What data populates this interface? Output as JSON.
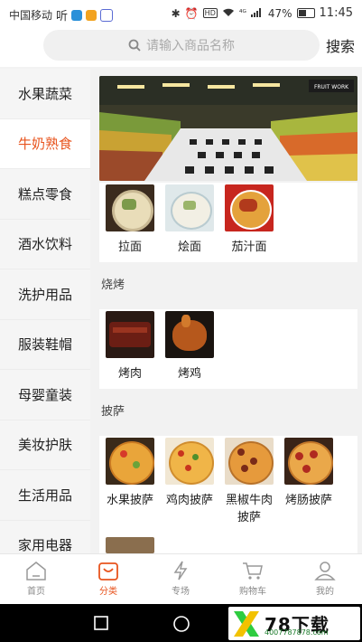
{
  "status": {
    "carrier": "中国移动",
    "hd": "HD",
    "network": "⁴ᴳ",
    "battery": "47%",
    "time": "11:45"
  },
  "search": {
    "placeholder": "请输入商品名称",
    "button": "搜索"
  },
  "sidebar": {
    "items": [
      {
        "label": "水果蔬菜"
      },
      {
        "label": "牛奶熟食",
        "active": true
      },
      {
        "label": "糕点零食"
      },
      {
        "label": "酒水饮料"
      },
      {
        "label": "洗护用品"
      },
      {
        "label": "服装鞋帽"
      },
      {
        "label": "母婴童装"
      },
      {
        "label": "美妆护肤"
      },
      {
        "label": "生活用品"
      },
      {
        "label": "家用电器"
      }
    ]
  },
  "banner": {
    "sign": "FRUIT WORK"
  },
  "sections": [
    {
      "title": "",
      "items": [
        {
          "name": "拉面"
        },
        {
          "name": "烩面"
        },
        {
          "name": "茄汁面"
        }
      ]
    },
    {
      "title": "烧烤",
      "items": [
        {
          "name": "烤肉"
        },
        {
          "name": "烤鸡"
        }
      ]
    },
    {
      "title": "披萨",
      "items": [
        {
          "name": "水果披萨"
        },
        {
          "name": "鸡肉披萨"
        },
        {
          "name": "黑椒牛肉披萨"
        },
        {
          "name": "烤肠披萨"
        }
      ]
    }
  ],
  "tabs": [
    {
      "label": "首页",
      "icon": "home-icon"
    },
    {
      "label": "分类",
      "icon": "bag-icon",
      "active": true
    },
    {
      "label": "专场",
      "icon": "lightning-icon"
    },
    {
      "label": "购物车",
      "icon": "cart-icon"
    },
    {
      "label": "我的",
      "icon": "user-icon"
    }
  ],
  "watermark": {
    "text": "78下载",
    "url": "4007787878.com"
  },
  "colors": {
    "accent": "#e8541e"
  }
}
